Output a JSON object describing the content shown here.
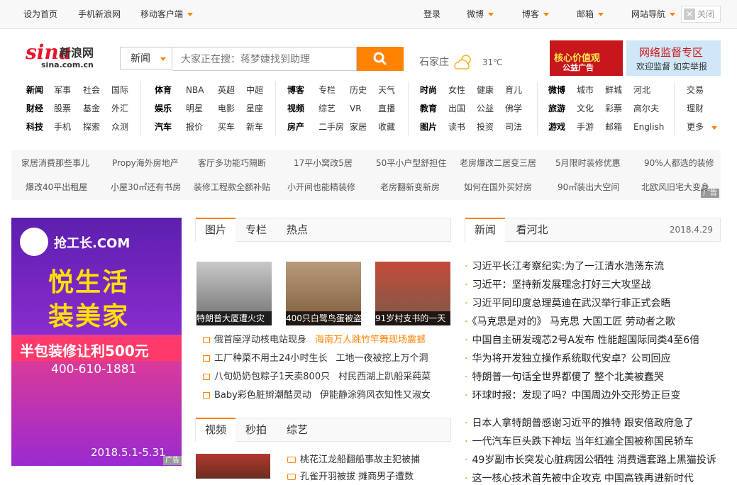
{
  "topbar": {
    "set_home": "设为首页",
    "mobile_sina": "手机新浪网",
    "mobile_client": "移动客户端",
    "login": "登录",
    "weibo": "微博",
    "blog": "博客",
    "mail": "邮箱",
    "site_nav": "网站导航",
    "close": "关闭"
  },
  "header": {
    "logo_text": "sina",
    "logo_cn": "新浪网",
    "logo_url": "sina.com.cn",
    "search_category": "新闻",
    "search_placeholder": "大家正在搜：蒋梦婕找到助理",
    "city": "石家庄",
    "temperature": "31℃",
    "ad1_line1": "核心价值观",
    "ad1_line2": "公益广告",
    "ad2_line1": "网络监督专区",
    "ad2_line2": "欢迎监督 如实举报"
  },
  "nav": {
    "col1": [
      [
        "新闻",
        "军事",
        "社会",
        "国际"
      ],
      [
        "财经",
        "股票",
        "基金",
        "外汇"
      ],
      [
        "科技",
        "手机",
        "探索",
        "众测"
      ]
    ],
    "col2": [
      [
        "体育",
        "NBA",
        "英超",
        "中超"
      ],
      [
        "娱乐",
        "明星",
        "电影",
        "星座"
      ],
      [
        "汽车",
        "报价",
        "买车",
        "新车"
      ]
    ],
    "col3": [
      [
        "博客",
        "专栏",
        "历史",
        "天气"
      ],
      [
        "视频",
        "综艺",
        "VR",
        "直播"
      ],
      [
        "房产",
        "二手房",
        "家居",
        "收藏"
      ]
    ],
    "col4": [
      [
        "时尚",
        "女性",
        "健康",
        "育儿"
      ],
      [
        "教育",
        "出国",
        "公益",
        "佛学"
      ],
      [
        "图片",
        "读书",
        "投资",
        "司法"
      ]
    ],
    "col5": [
      [
        "微博",
        "城市",
        "鲜城",
        "河北"
      ],
      [
        "旅游",
        "文化",
        "彩票",
        "高尔夫"
      ],
      [
        "游戏",
        "手游",
        "邮箱",
        "English"
      ]
    ],
    "col6": [
      "交易",
      "理财",
      "更多"
    ]
  },
  "tags": {
    "row1": [
      "家居消费那些事儿",
      "Propy海外房地产",
      "客厅多功能巧隔断",
      "17平小窝改5居",
      "50平小户型舒担住",
      "老房爆改二居变三居",
      "5月限时装修优惠",
      "90%人都选的装修"
    ],
    "row2": [
      "爆改40平出租屋",
      "小屋30㎡还有书房",
      "装修工程款全额补贴",
      "小开间也能精装修",
      "老房翻新变新房",
      "如何在国外买好房",
      "90㎡装出大空间",
      "北欧风旧宅大变身"
    ],
    "ad_label": "广告"
  },
  "left_ad": {
    "brand": "抢工长.COM",
    "headline1": "悦生活",
    "headline2": "装美家",
    "offer": "半包装修让利500元",
    "phone": "400-610-1881",
    "date": "2018.5.1-5.31",
    "ad_label": "广告"
  },
  "photo_section": {
    "tabs": [
      "图片",
      "专栏",
      "热点"
    ],
    "thumbs": [
      "特朗普大厦遭火灾",
      "400只白鹭鸟蛋被盗",
      "91岁村支书的一天"
    ],
    "items": [
      {
        "a": "俄首座浮动核电站现身",
        "b": "海南万人跳竹竿舞现场震撼"
      },
      {
        "a": "工厂种菜不用土24小时生长",
        "b": "工地一夜被挖上万个洞"
      },
      {
        "a": "八旬奶奶包粽子1天卖800只",
        "b": "村民西湖上趴船采莼菜"
      },
      {
        "a": "Baby彩色脏辫潮酷灵动",
        "b": "伊能静涂鸦风衣知性又淑女"
      }
    ]
  },
  "video_section": {
    "tabs": [
      "视频",
      "秒拍",
      "综艺"
    ],
    "items": [
      "桃花江龙船翻船事故主犯被捕",
      "孔雀开羽被拔 摊商男子遭数"
    ]
  },
  "news_section": {
    "tabs": [
      "新闻",
      "看河北"
    ],
    "date": "2018.4.29",
    "group1": [
      "习近平长江考察纪实:为了一江清水浩荡东流",
      "习近平：坚持新发展理念打好三大攻坚战",
      "习近平同印度总理莫迪在武汉举行非正式会晤",
      "《马克思是对的》 马克思 大国工匠 劳动者之歌",
      "中国自主研发魂芯2号A发布 性能超国际同类4至6倍",
      "华为将开发独立操作系统取代安卓？公司回应",
      "特朗普一句话全世界都傻了 整个北美被蠢哭",
      "环球时报：发现了吗？中国周边外交形势正巨变"
    ],
    "group2": [
      "日本人拿特朗普感谢习近平的推特 跟安倍政府急了",
      "一代汽车巨头跌下神坛 当年红遍全国被称国民轿车",
      "49岁副市长突发心脏病因公牺牲 消费遇套路上黑猫投诉",
      "这一核心技术首先被中企攻克 中国高铁再进新时代"
    ]
  }
}
